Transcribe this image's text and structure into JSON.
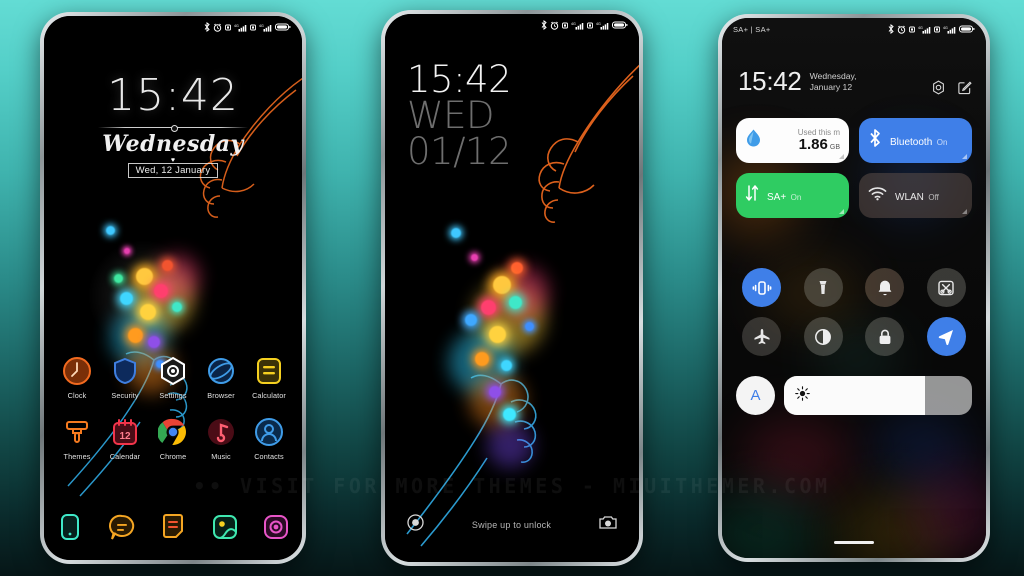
{
  "watermark": "•• VISIT FOR MORE THEMES - MIUITHEMER.COM",
  "colors": {
    "background_top": "#63dcd4",
    "background_bottom": "#061617",
    "accent_blue": "#3f7fe8",
    "accent_green": "#2fcc62",
    "tile_white": "#fdfdfd"
  },
  "status_bar": {
    "carrier": "SA+ | SA+",
    "icons": [
      "bluetooth-icon",
      "alarm-icon",
      "sim1-signal-icon",
      "sim2-signal-icon",
      "battery-icon"
    ],
    "network_label": "4G"
  },
  "phone_left": {
    "label": "home-screen",
    "clock": {
      "time": "15:42",
      "day": "Wednesday",
      "heart": "♥",
      "date": "Wed, 12 January"
    },
    "apps_row1": [
      {
        "label": "Clock",
        "icon": "clock-icon",
        "color": "#f26a1f"
      },
      {
        "label": "Security",
        "icon": "shield-icon",
        "color": "#2f6fe0"
      },
      {
        "label": "Settings",
        "icon": "settings-hex-icon",
        "color": "#ffffff"
      },
      {
        "label": "Browser",
        "icon": "browser-planet-icon",
        "color": "#2f8fe0"
      },
      {
        "label": "Calculator",
        "icon": "calculator-icon",
        "color": "#f5d020"
      }
    ],
    "apps_row2": [
      {
        "label": "Themes",
        "icon": "themes-brush-icon",
        "color": "#f57a1f"
      },
      {
        "label": "Calendar",
        "icon": "calendar-icon",
        "color": "#f2344a",
        "day_number": "12"
      },
      {
        "label": "Chrome",
        "icon": "chrome-icon",
        "color": "#4285f4"
      },
      {
        "label": "Music",
        "icon": "music-note-icon",
        "color": "#f2344a"
      },
      {
        "label": "Contacts",
        "icon": "contacts-icon",
        "color": "#3f9ce8"
      }
    ],
    "dock": [
      {
        "label": "Phone",
        "icon": "phone-icon",
        "color": "#3fe8c8"
      },
      {
        "label": "Messages",
        "icon": "messages-icon",
        "color": "#f5a623"
      },
      {
        "label": "Notes",
        "icon": "notes-icon",
        "color": "#f5a623"
      },
      {
        "label": "Gallery",
        "icon": "gallery-icon",
        "color": "#3fe8b0"
      },
      {
        "label": "Camera",
        "icon": "camera-icon",
        "color": "#e855c8"
      }
    ]
  },
  "phone_middle": {
    "label": "lock-screen",
    "clock": {
      "time": "15:42",
      "weekday": "WED",
      "date": "01/12"
    },
    "bottom": {
      "left_icon": "record-circle-icon",
      "hint": "Swipe up to unlock",
      "right_icon": "camera-icon"
    }
  },
  "phone_right": {
    "label": "control-center",
    "carrier": "SA+ | SA+",
    "header": {
      "time": "15:42",
      "date": "Wednesday, January 12",
      "settings_icon": "gear-icon",
      "edit_icon": "edit-icon"
    },
    "tiles": [
      {
        "name": "data-usage",
        "icon": "data-drop-icon",
        "label": "Used this m",
        "value": "1.86",
        "unit": "GB",
        "state": "active-white"
      },
      {
        "name": "bluetooth",
        "icon": "bluetooth-icon",
        "label": "Bluetooth",
        "sub": "On",
        "state": "active-blue"
      },
      {
        "name": "mobile-data",
        "icon": "data-arrows-icon",
        "label": "SA+",
        "sub": "On",
        "state": "active-green"
      },
      {
        "name": "wlan",
        "icon": "wifi-icon",
        "label": "WLAN",
        "sub": "Off",
        "state": "inactive"
      }
    ],
    "toggles": [
      {
        "name": "vibrate",
        "icon": "vibrate-icon",
        "state": "on"
      },
      {
        "name": "flashlight",
        "icon": "flashlight-icon",
        "state": "off"
      },
      {
        "name": "ringer",
        "icon": "bell-icon",
        "state": "off"
      },
      {
        "name": "screenshot",
        "icon": "screenshot-icon",
        "state": "off"
      },
      {
        "name": "airplane-mode",
        "icon": "airplane-icon",
        "state": "off"
      },
      {
        "name": "dark-mode",
        "icon": "contrast-icon",
        "state": "off"
      },
      {
        "name": "lock",
        "icon": "lock-icon",
        "state": "off"
      },
      {
        "name": "location",
        "icon": "location-arrow-icon",
        "state": "on"
      }
    ],
    "brightness": {
      "auto_label": "A",
      "auto_icon": "auto-brightness-icon",
      "slider_icon": "sun-icon",
      "level_percent": 75
    },
    "home_indicator": "home-bar"
  }
}
